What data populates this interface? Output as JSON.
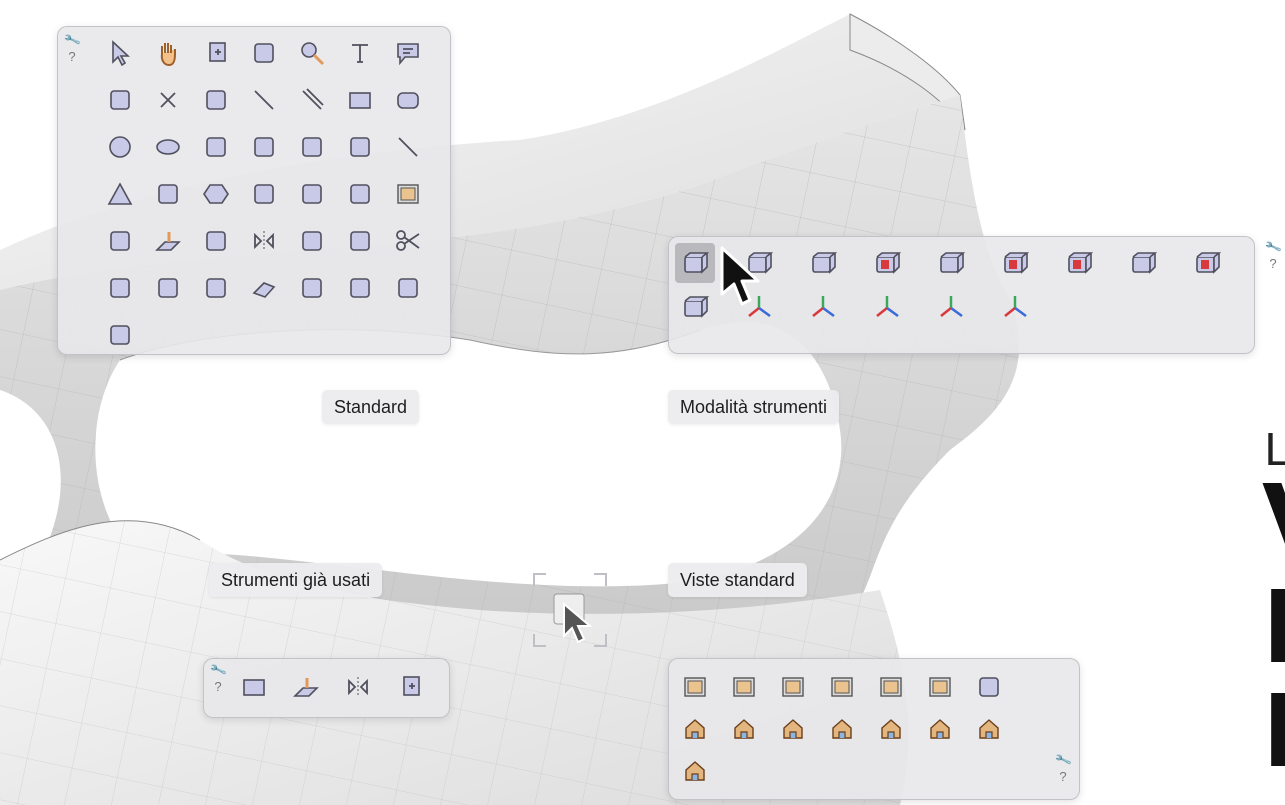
{
  "labels": {
    "standard": "Standard",
    "modalita": "Modalità strumenti",
    "usati": "Strumenti già usati",
    "viste": "Viste standard"
  },
  "help": "?",
  "heading": {
    "small": "LA",
    "line1": "V",
    "line2": "D",
    "line3": "D"
  },
  "icons": {
    "standard": [
      "select-arrow-icon",
      "pan-hand-icon",
      "new-sheet-icon",
      "orbit-icon",
      "zoom-icon",
      "text-icon",
      "callout-icon",
      "point-icon",
      "delete-x-icon",
      "extrude-icon",
      "line-icon",
      "double-line-icon",
      "rectangle-icon",
      "rounded-rectangle-icon",
      "circle-icon",
      "ellipse-icon",
      "arc-icon",
      "arc-center-icon",
      "spiral-curve-icon",
      "freeform-icon",
      "polyline-icon",
      "triangle-icon",
      "polygon-freeform-icon",
      "hexagon-icon",
      "paint-fill-icon",
      "eyedropper-icon",
      "magic-wand-icon",
      "view-eye-icon",
      "offset-icon",
      "push-pull-icon",
      "rotate-icon",
      "mirror-icon",
      "knife-icon",
      "intersect-icon",
      "scissors-icon",
      "fillet-icon",
      "chamfer-icon",
      "round-corner-icon",
      "eraser-icon",
      "move-icon",
      "scale-icon",
      "dimension-icon",
      "link-icon"
    ],
    "modalita_row1": [
      "object-mode-icon",
      "vertex-mode-icon",
      "edge-mode-icon",
      "face-mode-icon",
      "solid-mode-icon",
      "surface-mode-icon",
      "volume-mode-icon",
      "add-mode-icon",
      "subtract-mode-icon"
    ],
    "modalita_row2": [
      "multi-mode-icon",
      "gizmo-rotate-icon",
      "gizmo-move-icon",
      "gizmo-select-icon",
      "gizmo-frame-icon",
      "gizmo-plane-icon"
    ],
    "usati": [
      "rectangle-icon",
      "push-pull-icon",
      "mirror-icon",
      "new-sheet-icon"
    ],
    "viste": [
      "front-view-icon",
      "top-view-icon",
      "right-view-icon",
      "left-view-icon",
      "back-view-icon",
      "bottom-view-icon",
      "iso-front-icon",
      "house-1-icon",
      "house-2-icon",
      "house-3-icon",
      "house-4-icon",
      "house-5-icon",
      "house-6-icon",
      "house-7-icon",
      "house-8-icon"
    ]
  },
  "colors": {
    "icon_fill": "#c9c9e8",
    "icon_stroke": "#50505f",
    "accent_red": "#d8393b",
    "accent_green": "#3aa85a",
    "accent_orange": "#e19a5b"
  }
}
